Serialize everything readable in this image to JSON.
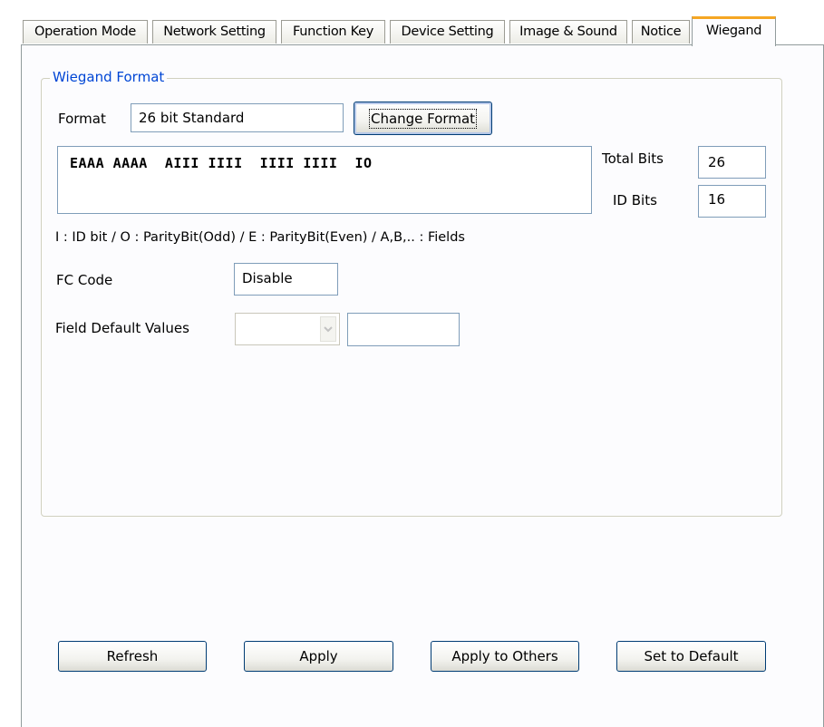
{
  "tabs": [
    {
      "label": "Operation Mode"
    },
    {
      "label": "Network Setting"
    },
    {
      "label": "Function Key"
    },
    {
      "label": "Device Setting"
    },
    {
      "label": "Image & Sound"
    },
    {
      "label": "Notice"
    },
    {
      "label": "Wiegand",
      "active": true
    }
  ],
  "group": {
    "title": "Wiegand Format"
  },
  "format": {
    "label": "Format",
    "value": "26 bit Standard",
    "change_button": "Change Format"
  },
  "bits": {
    "pattern": "EAAA AAAA  AIII IIII  IIII IIII  IO",
    "total_label": "Total Bits",
    "total_value": "26",
    "id_label": "ID Bits",
    "id_value": "16"
  },
  "legend": "I : ID bit  /  O : ParityBit(Odd)  /  E : ParityBit(Even)  /  A,B,.. : Fields",
  "fc_code": {
    "label": "FC Code",
    "value": "Disable"
  },
  "field_default": {
    "label": "Field Default Values",
    "select_value": "",
    "input_value": ""
  },
  "buttons": {
    "refresh": "Refresh",
    "apply": "Apply",
    "apply_others": "Apply to Others",
    "set_default": "Set to Default"
  },
  "icons": {
    "combo_arrow": "chevron-down-icon"
  },
  "colors": {
    "active_tab_accent": "#f5a623",
    "group_title": "#0046d5",
    "button_border": "#003c74"
  }
}
